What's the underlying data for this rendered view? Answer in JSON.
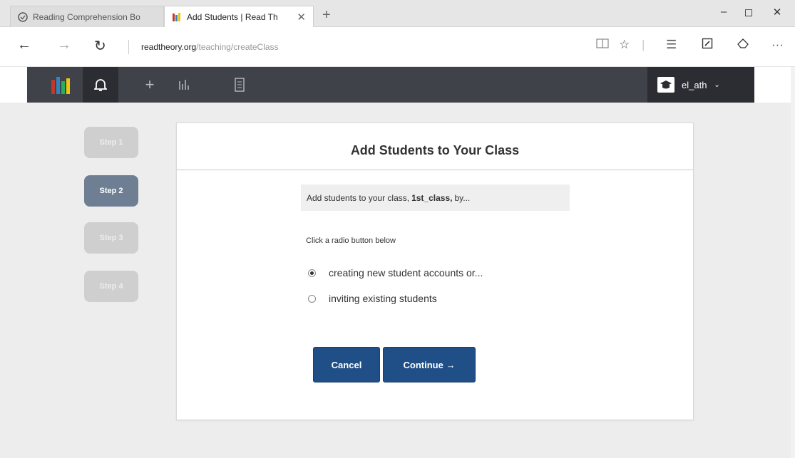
{
  "browser": {
    "tabs": [
      {
        "title": "Reading Comprehension Bo",
        "active": false
      },
      {
        "title": "Add Students | Read Th",
        "active": true
      }
    ],
    "new_tab": "+",
    "window_controls": {
      "minimize": "–",
      "maximize": "◻",
      "close": "✕"
    },
    "nav": {
      "back": "←",
      "forward": "→",
      "refresh": "↻"
    },
    "url": {
      "domain": "readtheory.org",
      "path": "/teaching/createClass"
    },
    "toolbar_icons": [
      "reading-view-icon",
      "favorite-icon",
      "hub-icon",
      "web-note-icon",
      "share-icon",
      "more-icon"
    ],
    "more_label": "···"
  },
  "appnav": {
    "user_name": "el_ath",
    "caret": "⌄",
    "logo_colors": [
      "#c0392b",
      "#2e86c1",
      "#27ae60",
      "#f1c40f"
    ]
  },
  "steps": [
    "Step 1",
    "Step 2",
    "Step 3",
    "Step 4"
  ],
  "active_step": 2,
  "card": {
    "title": "Add Students to Your Class",
    "info_prefix": "Add students to your class,",
    "class_name": "1st_class,",
    "info_suffix": "by...",
    "hint": "Click a radio button below",
    "options": [
      {
        "label": "creating new student accounts or...",
        "checked": true
      },
      {
        "label": "inviting existing students",
        "checked": false
      }
    ],
    "cancel_label": "Cancel",
    "continue_label": "Continue →"
  },
  "colors": {
    "accent": "#1f4f86",
    "active_step": "#6f7f93",
    "nav_bg": "#3f4249"
  }
}
